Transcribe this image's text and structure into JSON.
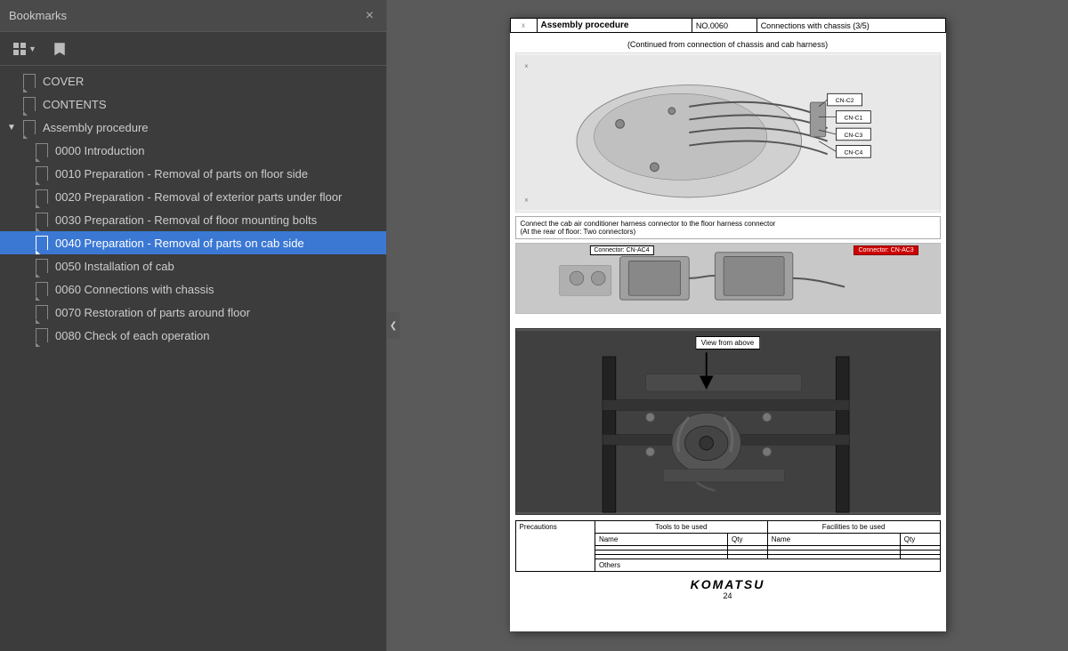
{
  "panel": {
    "title": "Bookmarks",
    "close_label": "×",
    "toolbar": {
      "view_btn_label": "▼",
      "bookmark_btn_label": "🔖"
    }
  },
  "bookmarks": {
    "items": [
      {
        "id": "cover",
        "label": "COVER",
        "indent": 0,
        "active": false,
        "expandable": false
      },
      {
        "id": "contents",
        "label": "CONTENTS",
        "indent": 0,
        "active": false,
        "expandable": false
      },
      {
        "id": "assembly",
        "label": "Assembly procedure",
        "indent": 0,
        "active": false,
        "expandable": true,
        "expanded": true
      },
      {
        "id": "0000",
        "label": "0000 Introduction",
        "indent": 2,
        "active": false,
        "expandable": false
      },
      {
        "id": "0010",
        "label": "0010 Preparation - Removal of parts on floor side",
        "indent": 2,
        "active": false,
        "expandable": false
      },
      {
        "id": "0020",
        "label": "0020 Preparation - Removal of exterior parts under floor",
        "indent": 2,
        "active": false,
        "expandable": false
      },
      {
        "id": "0030",
        "label": "0030 Preparation - Removal of floor mounting bolts",
        "indent": 2,
        "active": false,
        "expandable": false
      },
      {
        "id": "0040",
        "label": "0040 Preparation - Removal of parts on cab side",
        "indent": 2,
        "active": true,
        "expandable": false
      },
      {
        "id": "0050",
        "label": "0050 Installation of cab",
        "indent": 2,
        "active": false,
        "expandable": false
      },
      {
        "id": "0060",
        "label": "0060 Connections with chassis",
        "indent": 2,
        "active": false,
        "expandable": false
      },
      {
        "id": "0070",
        "label": "0070 Restoration of parts around floor",
        "indent": 2,
        "active": false,
        "expandable": false
      },
      {
        "id": "0080",
        "label": "0080 Check of each operation",
        "indent": 2,
        "active": false,
        "expandable": false
      }
    ]
  },
  "collapse_arrow": "❮",
  "document": {
    "header": {
      "procedure_label": "Assembly procedure",
      "number_label": "NO.0060",
      "title": "Connections with chassis (3/5)"
    },
    "subtitle": "(Continued from connection of chassis and cab harness)",
    "instruction": "Connect the cab air conditioner harness connector to the floor harness connector\n(At the rear of floor: Two connectors)",
    "connector1": "Connector: CN-AC4",
    "connector2": "Connector: CN-AC3",
    "connectors_in_diagram": [
      "CN-C2",
      "CN-C1",
      "CN-C3",
      "CN-C4"
    ],
    "view_label": "View from above",
    "bottom_table": {
      "precautions": "Precautions",
      "tools_header": "Tools to be used",
      "tools_name": "Name",
      "tools_qty": "Qty",
      "facilities_header": "Facilities to be used",
      "facilities_name": "Name",
      "facilities_qty": "Qty",
      "others": "Others"
    },
    "footer": {
      "logo": "KOMATSU",
      "page": "24"
    }
  }
}
